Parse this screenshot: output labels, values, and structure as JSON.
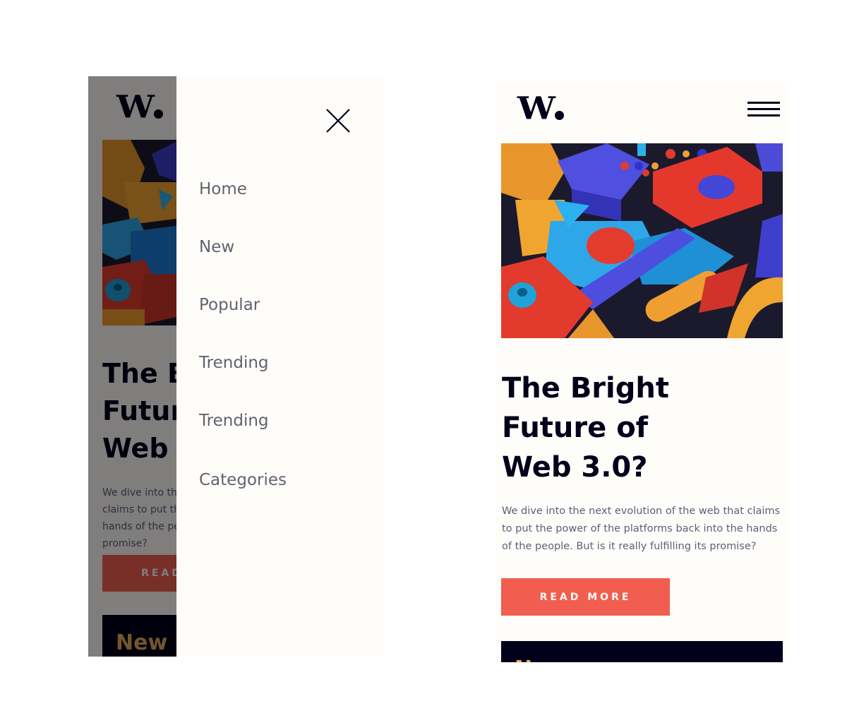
{
  "brand": {
    "logo_text": "W",
    "logo_dot": "."
  },
  "article": {
    "headline_lines": [
      "The Bright",
      "Future of",
      "Web 3.0?"
    ],
    "description": "We dive into the next evolution of the web that claims to put the power of the platforms back into the hands of the people. But is it really fulfilling its promise?",
    "read_more_label": "READ MORE"
  },
  "next_section": {
    "title": "New"
  },
  "menu": {
    "items": [
      {
        "label": "Home"
      },
      {
        "label": "New"
      },
      {
        "label": "Popular"
      },
      {
        "label": "Trending"
      },
      {
        "label": "Trending"
      },
      {
        "label": "Categories"
      }
    ]
  },
  "icons": {
    "close": "close-icon",
    "menu": "hamburger-menu-icon"
  },
  "colors": {
    "background": "#fffdf9",
    "accent": "#f15e50",
    "dark": "#00001a",
    "orange_heading": "#e9ab53",
    "body_text": "#5d5f79",
    "menu_text": "#62626e",
    "overlay": "rgba(0,0,0,0.5)"
  }
}
